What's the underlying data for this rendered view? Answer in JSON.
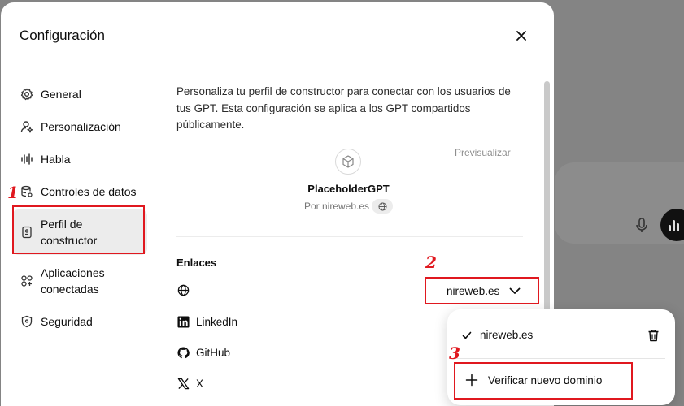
{
  "modal": {
    "title": "Configuración"
  },
  "nav": {
    "items": [
      {
        "label": "General",
        "icon": "gear-icon"
      },
      {
        "label": "Personalización",
        "icon": "person-sparkle-icon"
      },
      {
        "label": "Habla",
        "icon": "waveform-icon"
      },
      {
        "label": "Controles de datos",
        "icon": "database-icon"
      },
      {
        "label_line1": "Perfil de",
        "label_line2": "constructor",
        "icon": "id-badge-icon",
        "active": true
      },
      {
        "label_line1": "Aplicaciones",
        "label_line2": "conectadas",
        "icon": "apps-icon"
      },
      {
        "label": "Seguridad",
        "icon": "shield-icon"
      }
    ]
  },
  "profile": {
    "description": "Personaliza tu perfil de constructor para conectar con los usuarios de tus GPT. Esta configuración se aplica a los GPT compartidos públicamente.",
    "preview_label": "Previsualizar",
    "gpt_name": "PlaceholderGPT",
    "by_line": "Por nireweb.es"
  },
  "links": {
    "title": "Enlaces",
    "rows": [
      {
        "label": "",
        "icon": "globe-icon"
      },
      {
        "label": "LinkedIn",
        "icon": "linkedin-icon"
      },
      {
        "label": "GitHub",
        "icon": "github-icon"
      },
      {
        "label": "X",
        "icon": "x-logo-icon"
      }
    ],
    "domain_value": "nireweb.es"
  },
  "dropdown": {
    "selected_domain": "nireweb.es",
    "verify_label": "Verificar nuevo dominio"
  },
  "annotations": {
    "one": "1",
    "two": "2",
    "three": "3",
    "color": "#e0181f"
  }
}
